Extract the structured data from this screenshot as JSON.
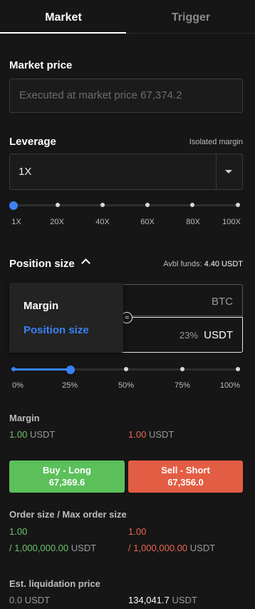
{
  "tabs": {
    "market": "Market",
    "trigger": "Trigger"
  },
  "market_price": {
    "title": "Market price",
    "placeholder": "Executed at market price 67,374.2"
  },
  "leverage": {
    "title": "Leverage",
    "mode": "Isolated margin",
    "value": "1X",
    "ticks": [
      "1X",
      "20X",
      "40X",
      "60X",
      "80X",
      "100X"
    ],
    "selected_index": 0
  },
  "position_size": {
    "title": "Position size",
    "avbl_label": "Avbl funds:",
    "avbl_value": "4.40 USDT",
    "btc_unit": "BTC",
    "approx_symbol": "≈",
    "usdt_percent": "23%",
    "usdt_unit": "USDT",
    "dropdown": [
      "Margin",
      "Position size"
    ],
    "dropdown_selected": "Position size",
    "slider_ticks": [
      "0%",
      "25%",
      "50%",
      "75%",
      "100%"
    ],
    "slider_value_percent": 25
  },
  "margin": {
    "title": "Margin",
    "long_value": "1.00",
    "short_value": "1.00",
    "unit": "USDT"
  },
  "buttons": {
    "buy_label": "Buy - Long",
    "buy_price": "67,369.6",
    "sell_label": "Sell - Short",
    "sell_price": "67,356.0"
  },
  "order_size": {
    "title": "Order size / Max order size",
    "long_value": "1.00",
    "long_max": "/ 1,000,000.00",
    "short_value": "1.00",
    "short_max": "/ 1,000,000.00",
    "unit": "USDT"
  },
  "liquidation": {
    "title": "Est. liquidation price",
    "long_value": "0.0",
    "short_value": "134,041.7",
    "unit": "USDT"
  },
  "colors": {
    "accent": "#3b82f6",
    "long": "#5cc05a",
    "short": "#e35d44",
    "background": "#161616"
  }
}
